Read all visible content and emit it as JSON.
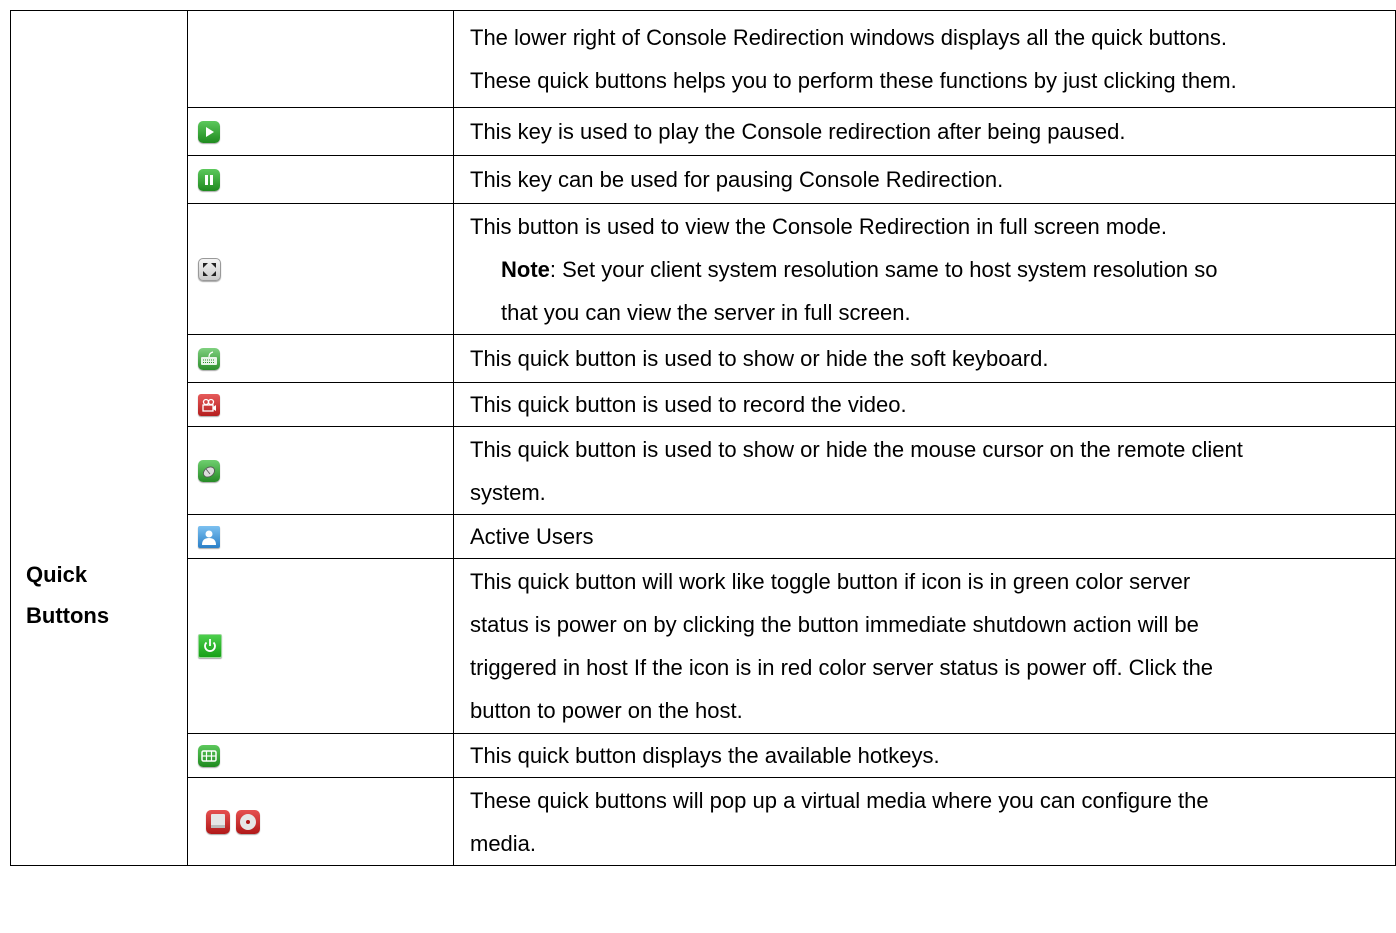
{
  "section": {
    "label_line1": "Quick",
    "label_line2": "Buttons"
  },
  "intro": {
    "line1": "The lower right of Console Redirection windows displays all the quick buttons.",
    "line2": "These quick buttons helps you to perform these functions by just clicking them."
  },
  "rows": [
    {
      "icon": "play-icon",
      "text": "This key is used to play the Console redirection after being paused."
    },
    {
      "icon": "pause-icon",
      "text": "This key can be used for pausing Console Redirection."
    },
    {
      "icon": "fullscreen-icon",
      "text": "This button is used to view the Console Redirection in full screen mode.",
      "note_label": "Note",
      "note_line1": ": Set your client system resolution same to host system resolution so",
      "note_line2": "that you can view the server in full screen."
    },
    {
      "icon": "keyboard-icon",
      "text": "This quick button is used to show or hide the soft keyboard."
    },
    {
      "icon": "record-video-icon",
      "text": "This quick button is used to record the video."
    },
    {
      "icon": "mouse-icon",
      "line1": "This quick button is used to show or hide the mouse cursor on the remote client",
      "line2": "system."
    },
    {
      "icon": "user-icon",
      "text": "Active Users"
    },
    {
      "icon": "power-icon",
      "line1": "This quick button will work like toggle button if icon is in green color server",
      "line2": "status is power on by clicking the button immediate shutdown action will be",
      "line3": "triggered in host If the icon is in red color server status is power off. Click the",
      "line4": "button to power on the host."
    },
    {
      "icon": "hotkeys-icon",
      "text": "This quick button displays the available hotkeys."
    },
    {
      "icon": "virtual-media-icon",
      "line1": "These quick buttons will pop up a virtual media where you can configure the",
      "line2": "media."
    }
  ],
  "colors": {
    "green": "#2f9a2f",
    "red": "#c8222a",
    "blue": "#3a8fd6",
    "border": "#000000"
  }
}
